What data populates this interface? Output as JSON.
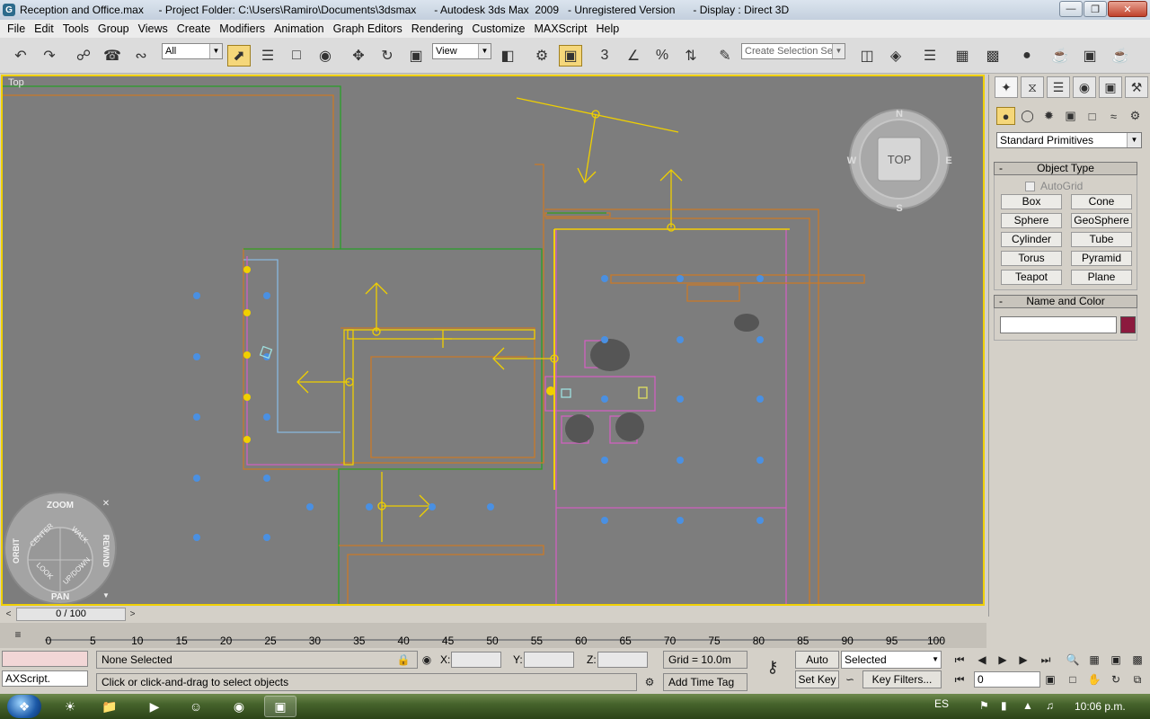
{
  "window": {
    "title": "Reception and Office.max     - Project Folder: C:\\Users\\Ramiro\\Documents\\3dsmax      - Autodesk 3ds Max  2009   - Unregistered Version      - Display : Direct 3D",
    "logo": "G",
    "controls": {
      "minimize": "minimize-icon",
      "maximize": "maximize-icon",
      "close": "close-icon"
    }
  },
  "menu": [
    "File",
    "Edit",
    "Tools",
    "Group",
    "Views",
    "Create",
    "Modifiers",
    "Animation",
    "Graph Editors",
    "Rendering",
    "Customize",
    "MAXScript",
    "Help"
  ],
  "toolbar": {
    "selection_filter": "All",
    "reference_coord": "View",
    "named_selection_placeholder": "Create Selection Set",
    "snap_label": "3"
  },
  "viewport": {
    "label": "Top",
    "viewcube_label": "TOP",
    "compass": {
      "n": "N",
      "s": "S",
      "e": "E",
      "w": "W"
    },
    "wheel": {
      "zoom": "ZOOM",
      "orbit": "ORBIT",
      "center": "CENTER",
      "walk": "WALK",
      "rewind": "REWIND",
      "look": "LOOK",
      "updown": "UP/DOWN",
      "pan": "PAN"
    },
    "colors": {
      "background": "#7d7d7d",
      "wall": "#c87a2a",
      "light": "#4a90e2",
      "selection": "#f0d000",
      "green": "#2aa02a",
      "magenta": "#d060c0"
    }
  },
  "command_panel": {
    "tabs": [
      "create-icon",
      "modify-icon",
      "hierarchy-icon",
      "motion-icon",
      "display-icon",
      "utilities-icon"
    ],
    "categories": [
      "geometry-icon",
      "shapes-icon",
      "lights-icon",
      "cameras-icon",
      "helpers-icon",
      "spacewarps-icon",
      "systems-icon"
    ],
    "dropdown": "Standard Primitives",
    "object_type": {
      "title": "Object Type",
      "autogrid": "AutoGrid",
      "buttons": [
        "Box",
        "Cone",
        "Sphere",
        "GeoSphere",
        "Cylinder",
        "Tube",
        "Torus",
        "Pyramid",
        "Teapot",
        "Plane"
      ]
    },
    "name_color": {
      "title": "Name and Color",
      "swatch": "#8c1a3e"
    }
  },
  "timeline": {
    "frame": "0 / 100",
    "ticks": [
      "0",
      "5",
      "10",
      "15",
      "20",
      "25",
      "30",
      "35",
      "40",
      "45",
      "50",
      "55",
      "60",
      "65",
      "70",
      "75",
      "80",
      "85",
      "90",
      "95",
      "100"
    ]
  },
  "status": {
    "maxscript": "AXScript.",
    "selection": "None Selected",
    "prompt": "Click or click-and-drag to select objects",
    "x_label": "X:",
    "y_label": "Y:",
    "z_label": "Z:",
    "grid": "Grid = 10.0m",
    "add_time_tag": "Add Time Tag",
    "auto_key": "Auto Key",
    "set_key": "Set Key",
    "key_mode": "Selected",
    "key_filters": "Key Filters...",
    "frame_value": "0"
  },
  "taskbar": {
    "lang": "ES",
    "time": "10:06 p.m."
  }
}
